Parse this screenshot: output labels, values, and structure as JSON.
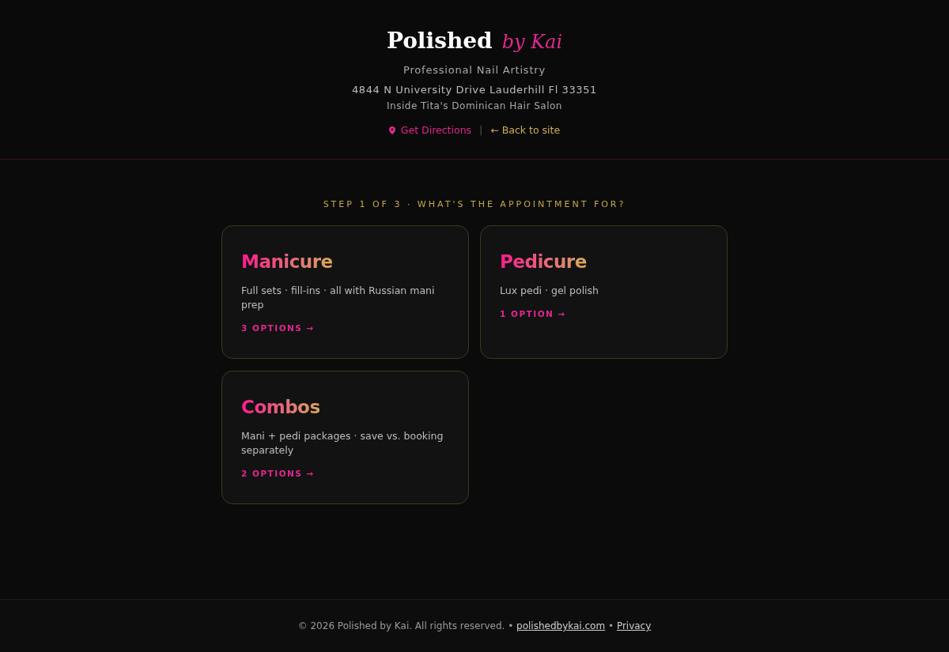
{
  "header": {
    "brand": {
      "name": "Polished",
      "script": "by Kai"
    },
    "tagline": "Professional Nail Artistry",
    "address": "4844 N University Drive Lauderhill Fl 33351",
    "location_note": "Inside Tita's Dominican Hair Salon",
    "links": [
      {
        "kind": "directions",
        "label": "Get Directions"
      },
      {
        "kind": "separator",
        "label": "|"
      },
      {
        "kind": "back",
        "label": "← Back to site"
      }
    ]
  },
  "step_label": "STEP 1 OF 3 · WHAT'S THE APPOINTMENT FOR?",
  "categories": [
    {
      "title": "Manicure",
      "description": "Full sets · fill-ins · all with Russian mani prep",
      "options": "3 OPTIONS →"
    },
    {
      "title": "Pedicure",
      "description": "Lux pedi · gel polish",
      "options": "1 OPTION →"
    },
    {
      "title": "Combos",
      "description": "Mani + pedi packages · save vs. booking separately",
      "options": "2 OPTIONS →"
    }
  ],
  "footer": [
    {
      "kind": "text",
      "text": "© 2026 Polished by Kai. All rights reserved. •"
    },
    {
      "kind": "link",
      "text": "polishedbykai.com"
    },
    {
      "kind": "text",
      "text": "•"
    },
    {
      "kind": "link",
      "text": "Privacy"
    }
  ]
}
